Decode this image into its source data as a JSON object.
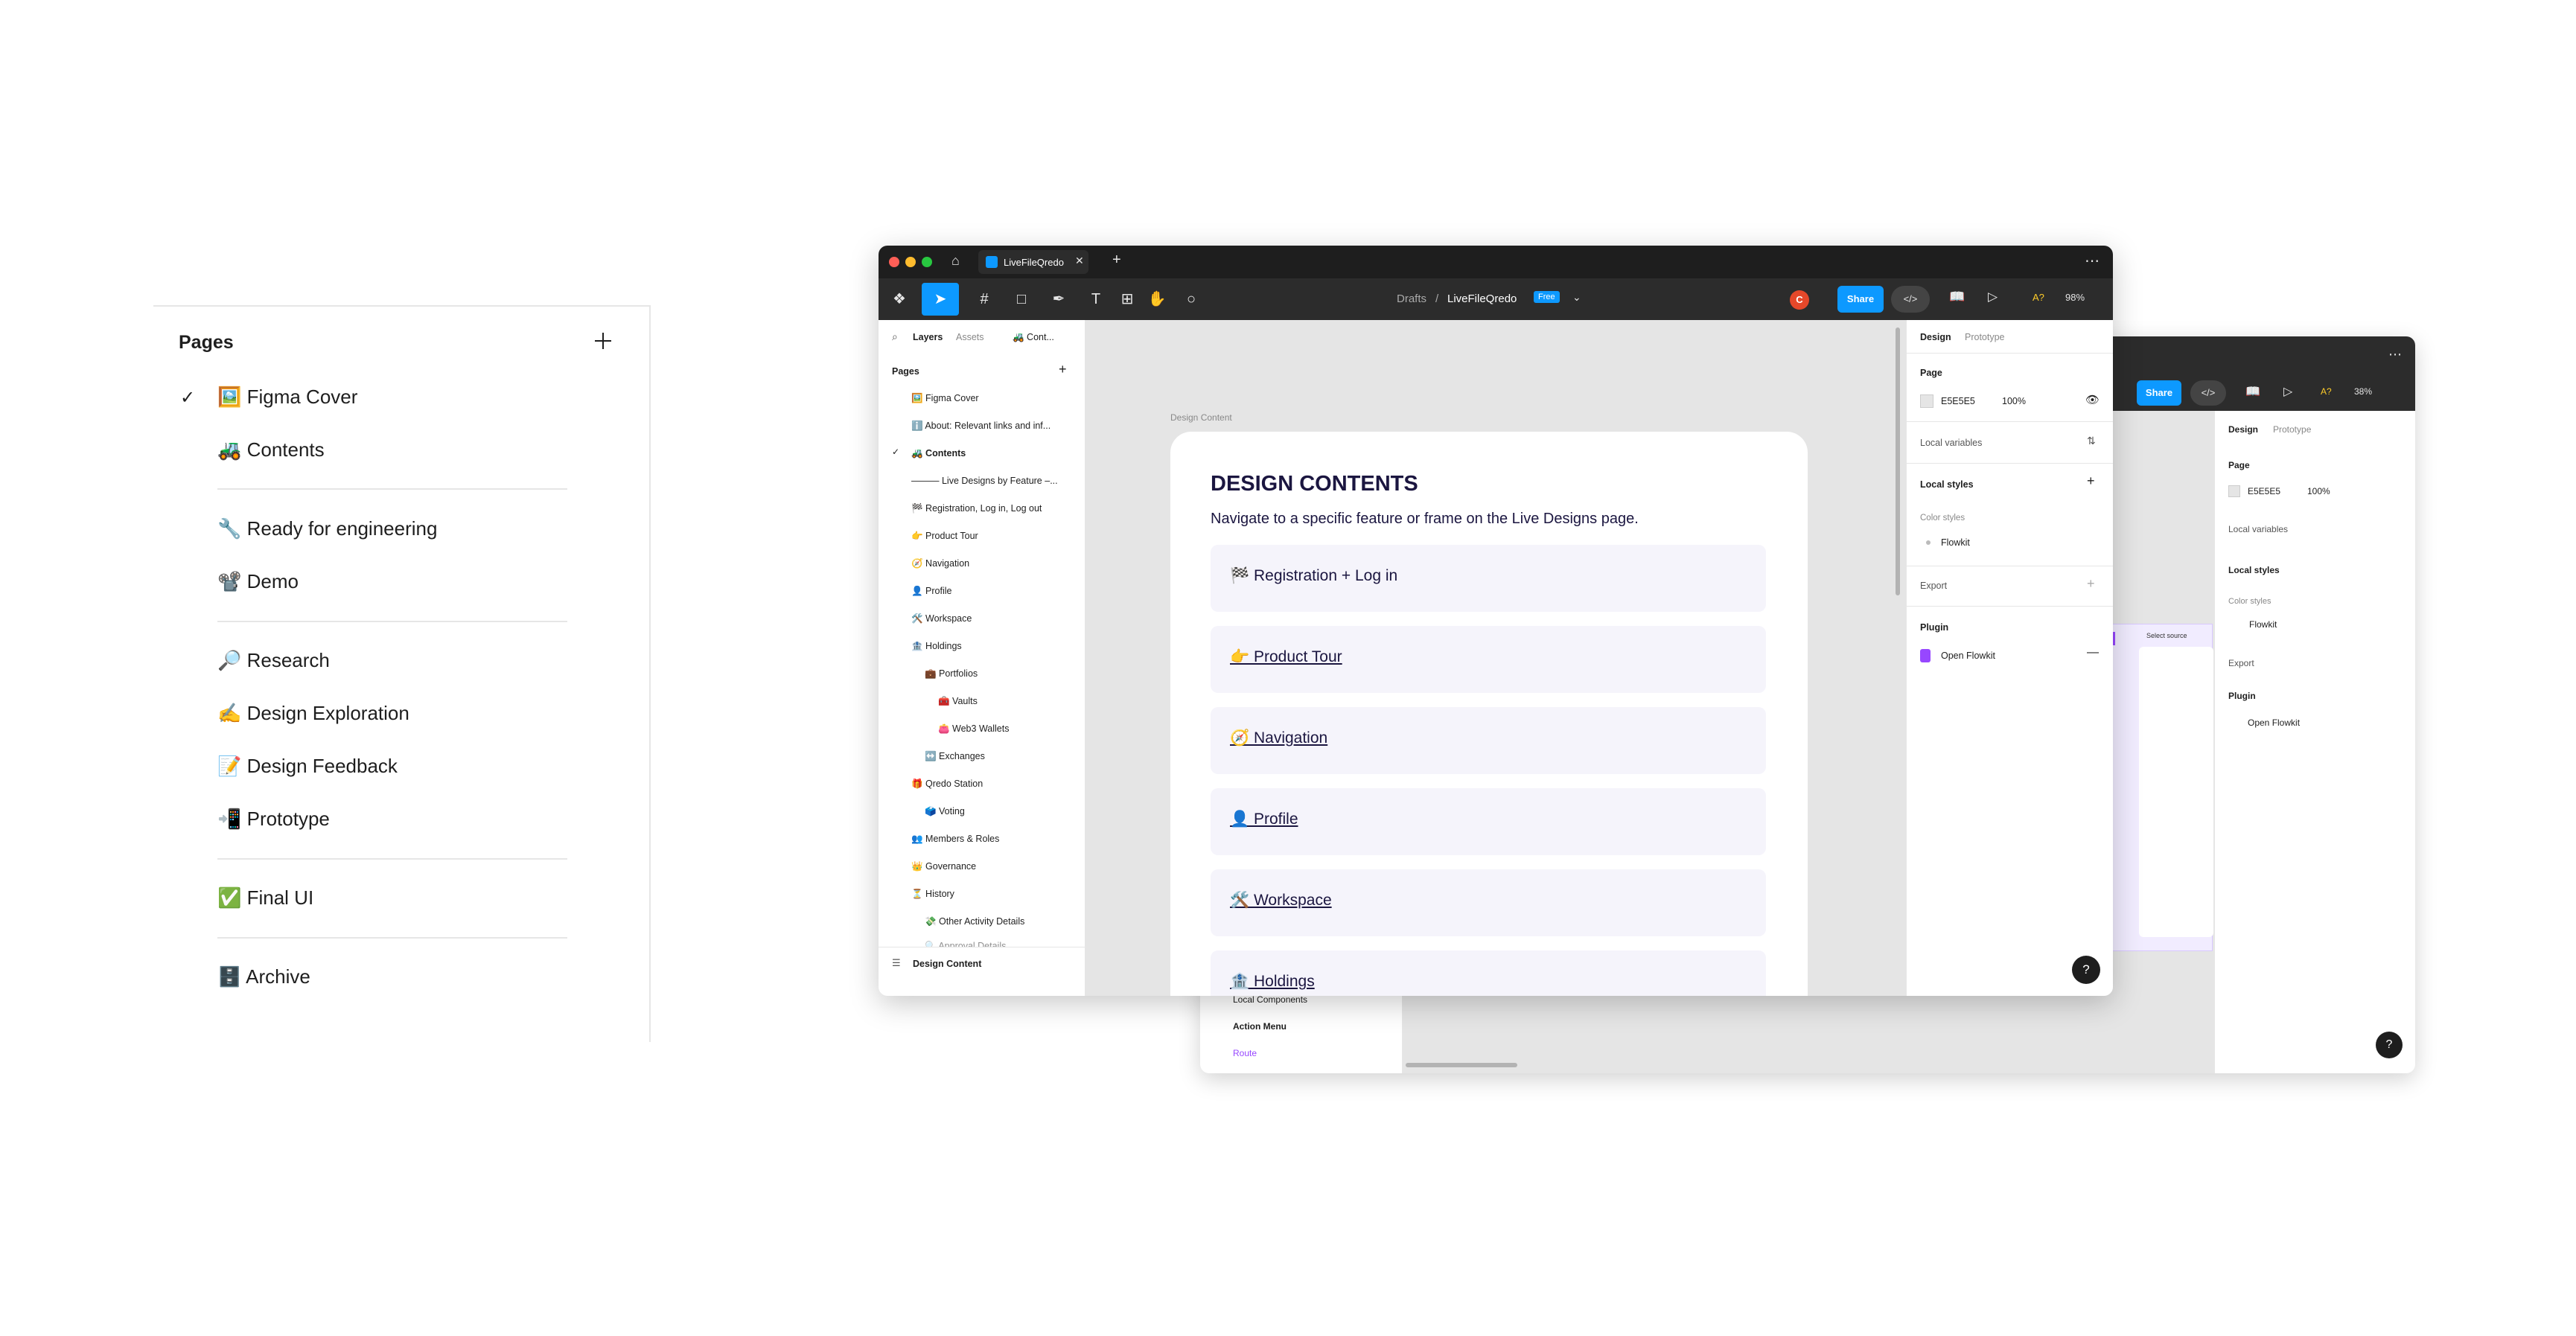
{
  "pages_panel": {
    "title": "Pages",
    "items": [
      {
        "label": "🖼️ Figma Cover",
        "checked": true
      },
      {
        "label": "🚜 Contents"
      },
      {
        "label": "🔧 Ready for engineering"
      },
      {
        "label": "📽️ Demo"
      },
      {
        "label": "🔎 Research"
      },
      {
        "label": "✍️ Design Exploration"
      },
      {
        "label": "📝 Design Feedback"
      },
      {
        "label": "📲 Prototype"
      },
      {
        "label": "✅ Final UI"
      },
      {
        "label": "🗄️ Archive"
      }
    ]
  },
  "front": {
    "tab_title": "LiveFileQredo",
    "breadcrumb": {
      "root": "Drafts",
      "sep": "/",
      "file": "LiveFileQredo",
      "badge": "Free"
    },
    "avatar_letter": "C",
    "share_label": "Share",
    "zoom": "98%",
    "a_label": "A?",
    "layers_tabs": [
      "Layers",
      "Assets",
      "🚜 Cont..."
    ],
    "pages_header": "Pages",
    "layer_items": [
      "🖼️ Figma Cover",
      "ℹ️ About: Relevant links and inf...",
      "🚜 Contents",
      "——— Live Designs by Feature –...",
      "🏁 Registration, Log in, Log out",
      "👉 Product Tour",
      "🧭 Navigation",
      "👤 Profile",
      "🛠️ Workspace",
      "🏦 Holdings",
      "💼 Portfolios",
      "🧰 Vaults",
      "👛 Web3 Wallets",
      "↔️ Exchanges",
      "🎁 Qredo Station",
      "🗳️ Voting",
      "👥 Members & Roles",
      "👑 Governance",
      "⏳ History",
      "💸 Other Activity Details",
      "🔍 Approval Details"
    ],
    "current_layer": "Design Content",
    "canvas_label": "Design Content",
    "frame": {
      "title": "DESIGN CONTENTS",
      "subtitle": "Navigate to a specific feature or frame on the Live Designs page.",
      "rows": [
        "🏁 Registration + Log in",
        "👉 Product Tour",
        "🧭 Navigation",
        "👤 Profile",
        "🛠️ Workspace",
        "🏦 Holdings"
      ]
    },
    "props": {
      "tabs": [
        "Design",
        "Prototype"
      ],
      "page_label": "Page",
      "bg_hex": "E5E5E5",
      "bg_opacity": "100%",
      "local_variables": "Local variables",
      "local_styles": "Local styles",
      "color_styles": "Color styles",
      "flowkit": "Flowkit",
      "export": "Export",
      "plugin": "Plugin",
      "open_flowkit": "Open Flowkit"
    },
    "help": "?"
  },
  "back": {
    "share_label": "Share",
    "zoom": "38%",
    "a_label": "A?",
    "layers": [
      "Local Components",
      "Action Menu",
      "Route"
    ],
    "props": {
      "tabs": [
        "Design",
        "Prototype"
      ],
      "page_label": "Page",
      "bg_hex": "E5E5E5",
      "bg_opacity": "100%",
      "local_variables": "Local variables",
      "local_styles": "Local styles",
      "color_styles": "Color styles",
      "flowkit": "Flowkit",
      "export": "Export",
      "plugin": "Plugin",
      "open_flowkit": "Open Flowkit"
    },
    "canvas_text": "Select source",
    "help": "?"
  },
  "colors": {
    "accent": "#0d99ff",
    "dark": "#2c2c2c",
    "canvas": "#e5e5e5",
    "frame_ink": "#1b1640",
    "purple": "#9747ff"
  }
}
